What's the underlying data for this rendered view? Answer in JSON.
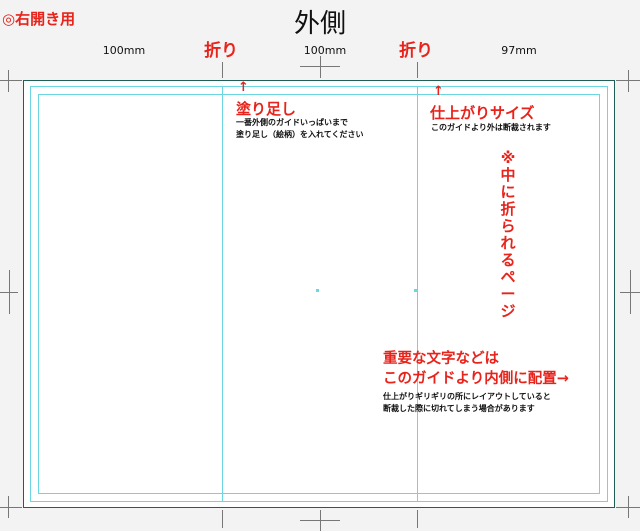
{
  "header": {
    "corner_label": "◎右開き用",
    "title": "外側"
  },
  "panels": {
    "widths": [
      "100mm",
      "100mm",
      "97mm"
    ]
  },
  "folds": {
    "label_left": "折り",
    "label_right": "折り"
  },
  "annotations": {
    "bleed": {
      "arrow": "↑",
      "title": "塗り足し",
      "line1": "一番外側のガイドいっぱいまで",
      "line2": "塗り足し（絵柄）を入れてください"
    },
    "trim": {
      "arrow": "↑",
      "title": "仕上がりサイズ",
      "line1": "このガイドより外は断裁されます"
    },
    "inner_fold": {
      "text": "※中に折られるページ"
    },
    "safe_area": {
      "title_line1": "重要な文字などは",
      "title_line2": "このガイドより内側に配置→",
      "line1": "仕上がりギリギリの所にレイアウトしていると",
      "line2": "断裁した際に切れてしまう場合があります"
    }
  },
  "colors": {
    "accent_red": "#e8231b",
    "guide_cyan": "#6ad7e3",
    "trim_border": "#1f5f57"
  }
}
